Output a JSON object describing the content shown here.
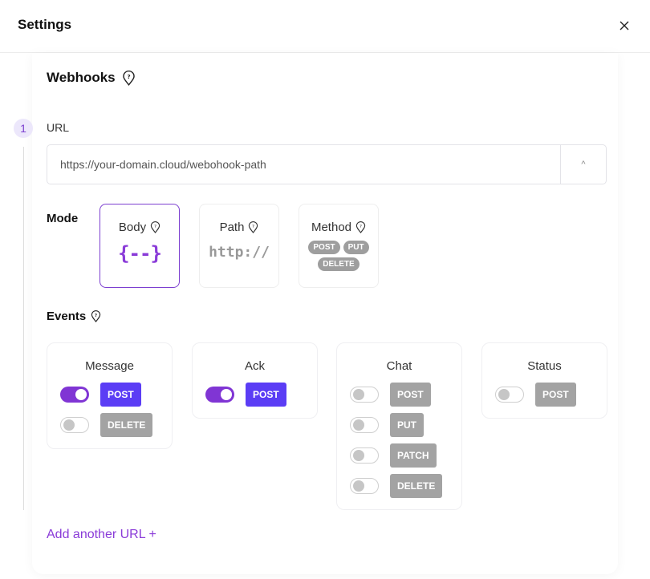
{
  "header": {
    "title": "Settings",
    "close_icon": "close-icon"
  },
  "webhooks": {
    "title": "Webhooks",
    "help_icon": "help-pin-icon",
    "step_number": "1",
    "url": {
      "label": "URL",
      "value": "https://your-domain.cloud/webohook-path",
      "toggle_icon": "chevron-up-icon",
      "toggle_glyph": "^"
    },
    "mode": {
      "label": "Mode",
      "selected": "Body",
      "options": [
        {
          "title": "Body",
          "visual": "{--}"
        },
        {
          "title": "Path",
          "visual": "http://"
        },
        {
          "title": "Method",
          "pills": [
            "POST",
            "PUT",
            "DELETE"
          ]
        }
      ]
    },
    "events": {
      "label": "Events",
      "groups": [
        {
          "title": "Message",
          "methods": [
            {
              "name": "POST",
              "enabled": true
            },
            {
              "name": "DELETE",
              "enabled": false
            }
          ]
        },
        {
          "title": "Ack",
          "methods": [
            {
              "name": "POST",
              "enabled": true
            }
          ]
        },
        {
          "title": "Chat",
          "methods": [
            {
              "name": "POST",
              "enabled": false
            },
            {
              "name": "PUT",
              "enabled": false
            },
            {
              "name": "PATCH",
              "enabled": false
            },
            {
              "name": "DELETE",
              "enabled": false
            }
          ]
        },
        {
          "title": "Status",
          "methods": [
            {
              "name": "POST",
              "enabled": false
            }
          ]
        }
      ]
    },
    "add_url_label": "Add another URL +"
  },
  "colors": {
    "accent_purple": "#8035d4",
    "active_method": "#5b3df5",
    "inactive_method": "#a3a3a3"
  }
}
